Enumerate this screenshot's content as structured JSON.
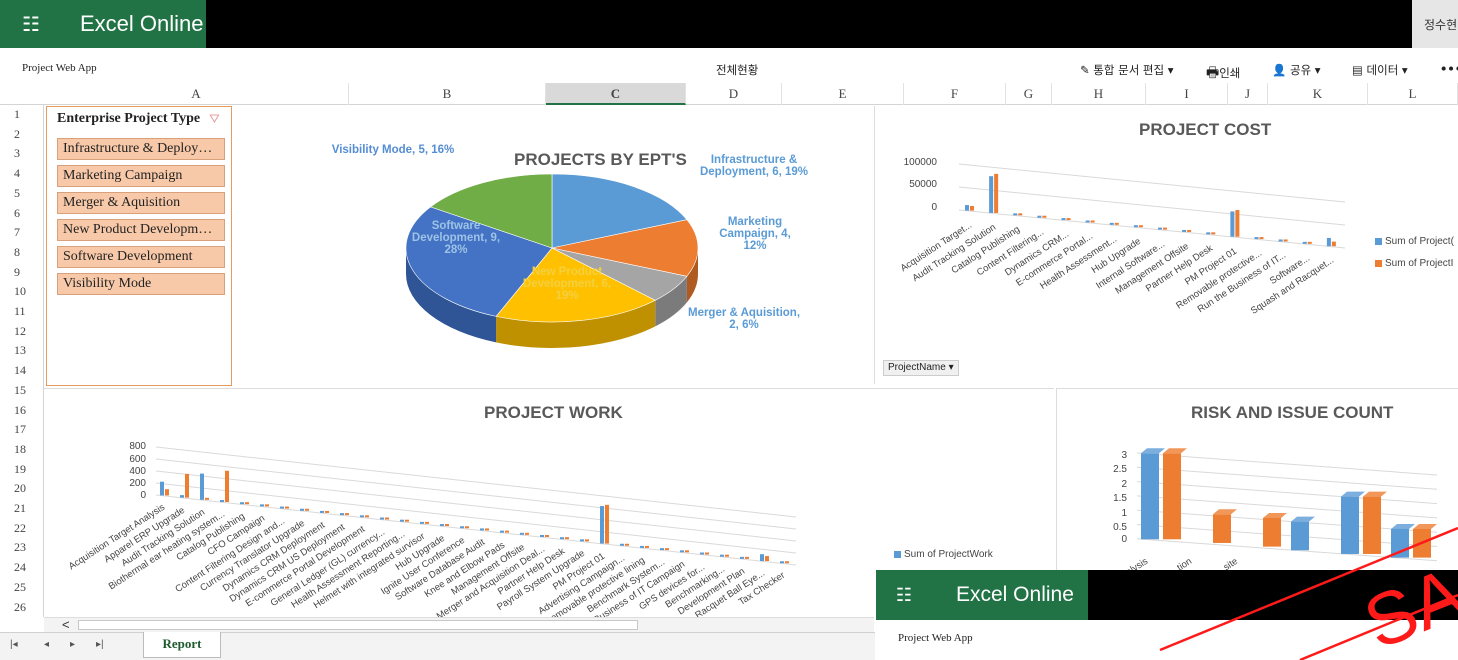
{
  "app": {
    "waffle_icon": "waffle-icon",
    "name": "Excel Online",
    "user": "정수현"
  },
  "toolbar": {
    "left_title": "Project Web App",
    "center_title": "전체현황",
    "edit_label": "통합 문서 편집",
    "print_label": "인쇄",
    "share_label": "공유",
    "data_label": "데이터",
    "more_label": "•••"
  },
  "columns": [
    "A",
    "B",
    "C",
    "D",
    "E",
    "F",
    "G",
    "H",
    "I",
    "J",
    "K",
    "L"
  ],
  "rows": [
    "1",
    "2",
    "3",
    "4",
    "5",
    "6",
    "7",
    "8",
    "9",
    "10",
    "11",
    "12",
    "13",
    "14",
    "15",
    "16",
    "17",
    "18",
    "19",
    "20",
    "21",
    "22",
    "23",
    "24",
    "25",
    "26"
  ],
  "slicer": {
    "title": "Enterprise Project Type",
    "items": [
      "Infrastructure & Deploy…",
      "Marketing Campaign",
      "Merger & Aquisition",
      "New Product Developm…",
      "Software Development",
      "Visibility Mode"
    ]
  },
  "charts": {
    "pie": {
      "title": "PROJECTS BY EPT'S",
      "labels": {
        "visibility": "Visibility Mode, 5, 16%",
        "infrastructure": "Infrastructure & Deployment, 6, 19%",
        "marketing": "Marketing Campaign, 4, 12%",
        "merger": "Merger & Aquisition, 2, 6%",
        "newproduct": "New Product Development, 6, 19%",
        "software": "Software Development, 9, 28%"
      }
    },
    "cost": {
      "title": "PROJECT COST",
      "ticks": [
        "100000",
        "50000",
        "0"
      ],
      "legend": [
        "Sum of Project(",
        "Sum of ProjectI"
      ],
      "filter": "ProjectName",
      "categories": [
        "Acquisition Target...",
        "Audit Tracking Solution",
        "Catalog Publishing",
        "Content Filtering...",
        "Dynamics CRM...",
        "E-commerce Portal...",
        "Health Assessment...",
        "Hub Upgrade",
        "Internal Software...",
        "Management Offsite",
        "Partner Help Desk",
        "PM Project 01",
        "Removable protective...",
        "Run the Business of IT...",
        "Software...",
        "Squash and Racquet..."
      ]
    },
    "work": {
      "title": "PROJECT WORK",
      "ticks": [
        "800",
        "600",
        "400",
        "200",
        "0"
      ],
      "legend": "Sum of ProjectWork",
      "categories": [
        "Acquisition Target Analysis",
        "Apparel ERP Upgrade",
        "Audit Tracking Solution",
        "Biothermal ear heating system...",
        "Catalog Publishing",
        "CFO Campaign",
        "Content Filtering Design and...",
        "Currency Translator Upgrade",
        "Dynamics CRM Deployment",
        "Dynamics CRM US Deployment",
        "E-commerce Portal Development",
        "General Ledger (GL) currency...",
        "Health Assessment Reporting...",
        "Helmet with integrated survisor",
        "Hub Upgrade",
        "Ignite User Conference",
        "Software Database Audit",
        "Knee and Elbow Pads",
        "Management Offsite",
        "Merger and Acquisition Deal...",
        "Partner Help Desk",
        "Payroll System Upgrade",
        "PM Project 01",
        "Advertising Campaign...",
        "Removable protective lining",
        "Benchmark System...",
        "Run the Business of IT Campaign",
        "GPS devices for...",
        "Benchmarking...",
        "Development Plan",
        "Racquet Ball Eye...",
        "Tax Checker"
      ]
    },
    "risk": {
      "title": "RISK AND ISSUE COUNT",
      "ticks": [
        "3",
        "2.5",
        "2",
        "1.5",
        "1",
        "0.5",
        "0"
      ],
      "categories": [
        "alysis",
        "tion",
        "site"
      ]
    }
  },
  "chart_data": [
    {
      "type": "pie",
      "title": "PROJECTS BY EPT'S",
      "categories": [
        "Infrastructure & Deployment",
        "Marketing Campaign",
        "Merger & Aquisition",
        "New Product Development",
        "Software Development",
        "Visibility Mode"
      ],
      "values": [
        6,
        4,
        2,
        6,
        9,
        5
      ],
      "percents": [
        19,
        12,
        6,
        19,
        28,
        16
      ],
      "colors": [
        "#5b9bd5",
        "#ed7d31",
        "#a5a5a5",
        "#ffc000",
        "#4472c4",
        "#70ad47"
      ]
    },
    {
      "type": "bar",
      "title": "PROJECT COST",
      "categories": [
        "Acquisition Target...",
        "Audit Tracking Solution",
        "Catalog Publishing",
        "Content Filtering...",
        "Dynamics CRM...",
        "E-commerce Portal...",
        "Health Assessment...",
        "Hub Upgrade",
        "Internal Software...",
        "Management Offsite",
        "Partner Help Desk",
        "PM Project 01",
        "Removable protective...",
        "Run the Business of IT...",
        "Software...",
        "Squash and Racquet..."
      ],
      "series": [
        {
          "values": [
            12000,
            80000,
            0,
            0,
            0,
            0,
            0,
            0,
            0,
            0,
            0,
            55000,
            0,
            0,
            0,
            18000
          ]
        },
        {
          "values": [
            10000,
            85000,
            0,
            0,
            0,
            0,
            0,
            0,
            0,
            0,
            0,
            58000,
            0,
            0,
            0,
            10000
          ]
        }
      ],
      "ylim": [
        0,
        100000
      ]
    },
    {
      "type": "bar",
      "title": "PROJECT WORK",
      "categories_count": 32,
      "series": [
        {
          "values": [
            220,
            40,
            420,
            0,
            0,
            0,
            0,
            0,
            0,
            0,
            0,
            0,
            0,
            0,
            0,
            0,
            0,
            0,
            0,
            0,
            0,
            0,
            600,
            0,
            0,
            0,
            0,
            0,
            0,
            0,
            110,
            0
          ]
        },
        {
          "values": [
            100,
            380,
            0,
            500,
            0,
            0,
            0,
            0,
            0,
            0,
            0,
            0,
            0,
            0,
            0,
            0,
            0,
            0,
            0,
            0,
            0,
            0,
            620,
            0,
            0,
            0,
            0,
            0,
            0,
            0,
            80,
            0
          ]
        }
      ],
      "ylim": [
        0,
        800
      ]
    },
    {
      "type": "bar",
      "title": "RISK AND ISSUE COUNT",
      "categories": [
        "alysis",
        "tion",
        "site"
      ],
      "series": [
        {
          "values": [
            3,
            0,
            0,
            1,
            2,
            1
          ]
        },
        {
          "values": [
            3,
            1,
            1,
            0,
            2,
            1
          ]
        }
      ],
      "ylim": [
        0,
        3
      ]
    }
  ],
  "sheet_tab": "Report",
  "overlay": {
    "app_name": "Excel Online",
    "title": "Project Web App",
    "watermark": "SA"
  }
}
